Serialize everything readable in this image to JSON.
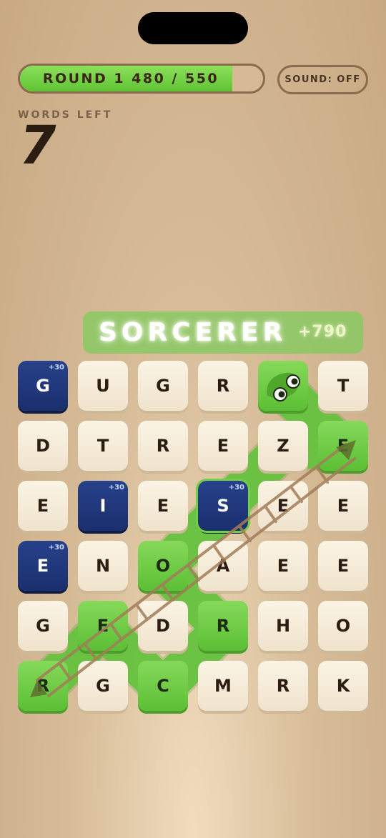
{
  "header": {
    "round_label": "ROUND 1 480 / 550",
    "progress_fraction": 0.8727,
    "sound_label": "SOUND: OFF"
  },
  "status": {
    "words_left_label": "WORDS LEFT",
    "words_left_count": "7"
  },
  "current_word": {
    "text": "SORCERER",
    "score": "+790"
  },
  "colors": {
    "green": "#6fcf45",
    "blue_tile": "#1f3579",
    "cream_tile": "#f6eddb",
    "ink": "#2b1d12"
  },
  "board": {
    "rows": [
      [
        {
          "l": "G",
          "t": "blue",
          "b": "+30"
        },
        {
          "l": "U",
          "t": "cream"
        },
        {
          "l": "G",
          "t": "cream"
        },
        {
          "l": "R",
          "t": "cream"
        },
        {
          "l": "",
          "t": "green",
          "icon": "snake-head"
        },
        {
          "l": "T",
          "t": "cream"
        }
      ],
      [
        {
          "l": "D",
          "t": "cream"
        },
        {
          "l": "T",
          "t": "cream"
        },
        {
          "l": "R",
          "t": "cream"
        },
        {
          "l": "E",
          "t": "cream"
        },
        {
          "l": "Z",
          "t": "cream"
        },
        {
          "l": "E",
          "t": "green"
        }
      ],
      [
        {
          "l": "E",
          "t": "cream"
        },
        {
          "l": "I",
          "t": "blue",
          "b": "+30"
        },
        {
          "l": "E",
          "t": "cream"
        },
        {
          "l": "S",
          "t": "blue",
          "b": "+30",
          "sel": true
        },
        {
          "l": "E",
          "t": "cream"
        },
        {
          "l": "E",
          "t": "cream"
        }
      ],
      [
        {
          "l": "E",
          "t": "blue",
          "b": "+30"
        },
        {
          "l": "N",
          "t": "cream"
        },
        {
          "l": "O",
          "t": "green"
        },
        {
          "l": "A",
          "t": "cream"
        },
        {
          "l": "E",
          "t": "cream"
        },
        {
          "l": "E",
          "t": "cream"
        }
      ],
      [
        {
          "l": "G",
          "t": "cream"
        },
        {
          "l": "E",
          "t": "green"
        },
        {
          "l": "D",
          "t": "cream"
        },
        {
          "l": "R",
          "t": "green"
        },
        {
          "l": "H",
          "t": "cream"
        },
        {
          "l": "O",
          "t": "cream"
        }
      ],
      [
        {
          "l": "R",
          "t": "green"
        },
        {
          "l": "G",
          "t": "cream"
        },
        {
          "l": "C",
          "t": "green"
        },
        {
          "l": "M",
          "t": "cream"
        },
        {
          "l": "R",
          "t": "cream"
        },
        {
          "l": "K",
          "t": "cream"
        }
      ]
    ]
  }
}
